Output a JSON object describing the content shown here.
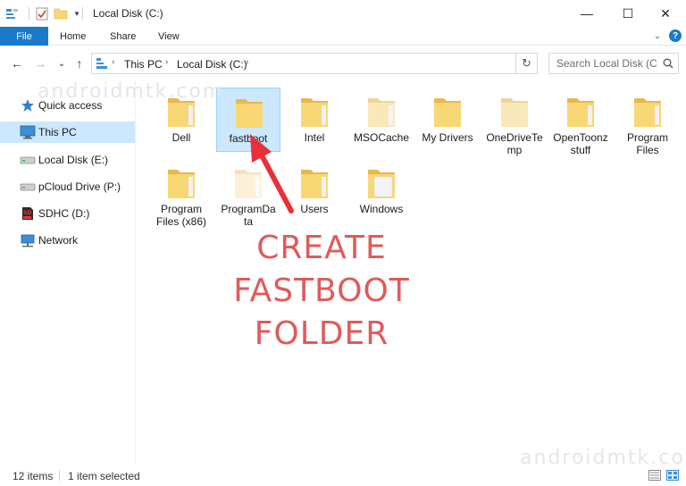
{
  "window": {
    "title": "Local Disk (C:)",
    "minimize": "—",
    "maximize": "☐",
    "close": "✕"
  },
  "ribbon": {
    "file_tab": "File",
    "tabs": [
      "Home",
      "Share",
      "View"
    ],
    "expand": "⌄",
    "help": "?"
  },
  "nav": {
    "back": "←",
    "forward": "→",
    "recent": "⌄",
    "up": "↑",
    "breadcrumb_sep": "›",
    "breadcrumbs": [
      "This PC",
      "Local Disk (C:)"
    ],
    "refresh": "↻",
    "search_placeholder": "Search Local Disk (C:)"
  },
  "sidebar": {
    "items": [
      {
        "label": "Quick access",
        "icon": "star-icon"
      },
      {
        "label": "This PC",
        "icon": "this-pc-icon",
        "selected": true
      },
      {
        "label": "Local Disk (E:)",
        "icon": "drive-icon"
      },
      {
        "label": "pCloud Drive (P:)",
        "icon": "drive-icon"
      },
      {
        "label": "SDHC (D:)",
        "icon": "sd-card-icon"
      },
      {
        "label": "Network",
        "icon": "network-icon"
      }
    ]
  },
  "folders": [
    {
      "label": "Dell"
    },
    {
      "label": "fastboot",
      "selected": true
    },
    {
      "label": "Intel"
    },
    {
      "label": "MSOCache"
    },
    {
      "label": "My Drivers"
    },
    {
      "label": "OneDriveTe mp"
    },
    {
      "label": "OpenToonz stuff"
    },
    {
      "label": "Program Files"
    },
    {
      "label": "Program Files (x86)"
    },
    {
      "label": "ProgramDa ta"
    },
    {
      "label": "Users"
    },
    {
      "label": "Windows"
    }
  ],
  "caption": {
    "line1": "CREATE",
    "line2": "FASTBOOT",
    "line3": "FOLDER"
  },
  "watermark": "androidmtk.com",
  "status": {
    "item_count": "12 items",
    "selection": "1 item selected"
  },
  "colors": {
    "accent": "#1979ca",
    "selection": "#cce8ff",
    "folder": "#f8d775",
    "caption": "#e05a5a",
    "arrow": "#e8303a"
  }
}
